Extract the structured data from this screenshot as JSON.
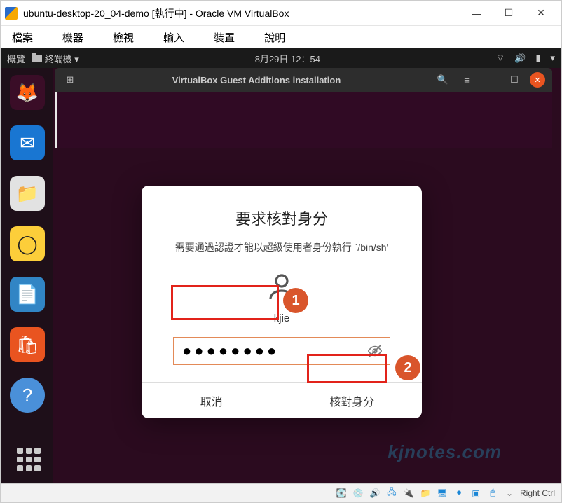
{
  "window": {
    "title": "ubuntu-desktop-20_04-demo [執行中] - Oracle VM VirtualBox"
  },
  "menubar": {
    "items": [
      "檔案",
      "機器",
      "檢視",
      "輸入",
      "裝置",
      "說明"
    ]
  },
  "topbar": {
    "overview": "概覽",
    "terminal_tab": "終端機",
    "datetime": "8月29日  12：54"
  },
  "termhead": {
    "title": "VirtualBox Guest Additions installation"
  },
  "dialog": {
    "title": "要求核對身分",
    "message": "需要通過認證才能以超級使用者身份執行 `/bin/sh'",
    "username": "kjie",
    "password_mask": "●●●●●●●●",
    "cancel": "取消",
    "confirm": "核對身分"
  },
  "callouts": {
    "one": "1",
    "two": "2"
  },
  "statusbar": {
    "hostkey": "Right Ctrl"
  },
  "watermark": "kjnotes.com"
}
